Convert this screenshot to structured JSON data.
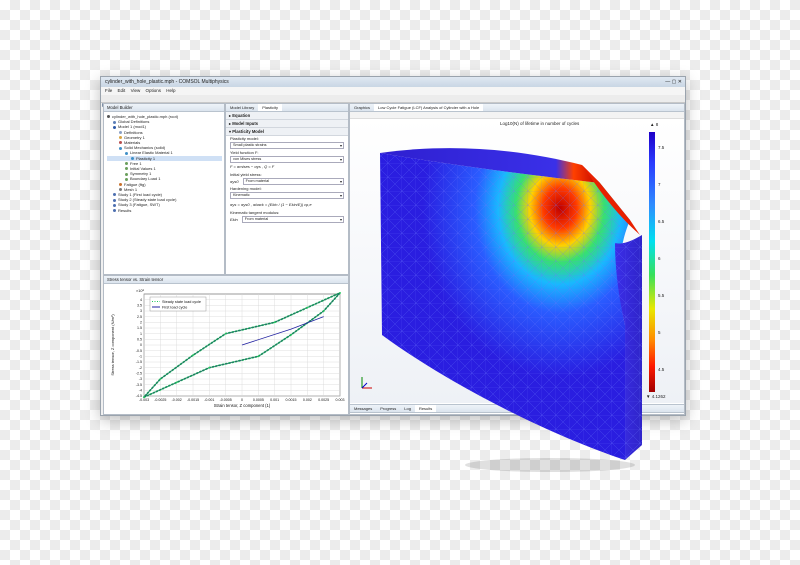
{
  "window": {
    "title": "cylinder_with_hole_plastic.mph - COMSOL Multiphysics"
  },
  "menu": [
    "File",
    "Edit",
    "View",
    "Options",
    "Help"
  ],
  "model_builder": {
    "title": "Model Builder",
    "root": "cylinder_with_hole_plastic.mph (root)",
    "items": [
      {
        "label": "Global Definitions",
        "color": "#5b7fb8"
      },
      {
        "label": "Model 1 (mod1)",
        "color": "#2e5aa8"
      },
      {
        "label": "Definitions",
        "color": "#8aa0c4"
      },
      {
        "label": "Geometry 1",
        "color": "#d9a441"
      },
      {
        "label": "Materials",
        "color": "#b84f4f"
      },
      {
        "label": "Solid Mechanics (solid)",
        "color": "#3f8fc7"
      },
      {
        "label": "Linear Elastic Material 1",
        "color": "#3f8fc7"
      },
      {
        "label": "Plasticity 1",
        "color": "#3f8fc7"
      },
      {
        "label": "Free 1",
        "color": "#6a9f5c"
      },
      {
        "label": "Initial Values 1",
        "color": "#6a9f5c"
      },
      {
        "label": "Symmetry 1",
        "color": "#6a9f5c"
      },
      {
        "label": "Boundary Load 1",
        "color": "#6a9f5c"
      },
      {
        "label": "Fatigue (ftg)",
        "color": "#c9722c"
      },
      {
        "label": "Mesh 1",
        "color": "#7a7a7a"
      },
      {
        "label": "Study 1 (First load cycle)",
        "color": "#4d6fb0"
      },
      {
        "label": "Study 2 (Steady state load cycle)",
        "color": "#4d6fb0"
      },
      {
        "label": "Study 3 (Fatigue, SWT)",
        "color": "#4d6fb0"
      },
      {
        "label": "Results",
        "color": "#4d6fb0"
      }
    ]
  },
  "settings": {
    "tabs": [
      "Model Library",
      "Plasticity"
    ],
    "sections": {
      "equation": "Equation",
      "model_inputs": "Model Inputs",
      "plasticity_model": "Plasticity Model"
    },
    "plasticity_model_label": "Plasticity model:",
    "plasticity_model_value": "Small plastic strains",
    "yield_function_label": "Yield function F:",
    "yield_function_value": "von Mises stress",
    "yield_formula": "F = σmises − σys ,  Q = F",
    "initial_yield_label": "Initial yield stress:",
    "initial_yield_symbol": "σys0",
    "initial_yield_value": "From material",
    "hardening_label": "Hardening model:",
    "hardening_value": "Kinematic",
    "hardening_formula": "σys = σys0 ,  σback = (Ekin / (1 − Ekin/E)) εp,e",
    "tangent_label": "Kinematic tangent modulus:",
    "tangent_symbol": "Ekin",
    "tangent_value": "From material"
  },
  "plot_panel": {
    "title": "Stress tensor vs. Strain tensor",
    "legend": [
      "Steady state load cycle",
      "First load cycle"
    ],
    "ylabel": "Stress tensor, Z component (N/m²)",
    "xlabel": "Strain tensor, Z component (1)",
    "exponent": "×10⁸"
  },
  "chart_data": {
    "type": "line",
    "title": "",
    "xlabel": "Strain tensor, Z component (1)",
    "ylabel": "Stress tensor, Z component (N/m²)",
    "xlim": [
      -0.003,
      0.003
    ],
    "ylim": [
      -4.5,
      4.5
    ],
    "y_scale_exponent": "×10⁸",
    "xticks": [
      "-0.003",
      "-0.0025",
      "-0.002",
      "-0.0015",
      "-0.001",
      "-0.0005",
      "0",
      "0.0005",
      "0.001",
      "0.0015",
      "0.002",
      "0.0025",
      "0.003"
    ],
    "yticks": [
      "4",
      "3.5",
      "3",
      "2.5",
      "2",
      "1.5",
      "1",
      "0.5",
      "0",
      "-0.5",
      "-1",
      "-1.5",
      "-2",
      "-2.5",
      "-3",
      "-3.5",
      "-4",
      "-4.5"
    ],
    "series": [
      {
        "name": "Steady state load cycle",
        "color": "#22c55e",
        "style": "dotted",
        "x": [
          -0.003,
          -0.002,
          -0.001,
          0.0005,
          0.0015,
          0.0025,
          0.003,
          0.002,
          0.001,
          -0.0005,
          -0.0015,
          -0.0025,
          -0.003
        ],
        "y": [
          -4.6,
          -3.3,
          -2.0,
          -1.0,
          0.9,
          3.0,
          4.6,
          3.3,
          2.0,
          1.0,
          -0.9,
          -3.0,
          -4.6
        ]
      },
      {
        "name": "First load cycle",
        "color": "#2020a0",
        "style": "solid",
        "x": [
          0,
          0.0015,
          0.0025
        ],
        "y": [
          0,
          1.4,
          2.5
        ]
      }
    ],
    "legend_position": "top-left",
    "grid": true
  },
  "graphics": {
    "tabs": [
      "Graphics",
      "Low Cycle Fatigue (LCF) Analysis of Cylinder with a Hole"
    ],
    "plot_title": "Log10(N) of lifetime in number of cycles",
    "colorbar": {
      "max_label": "▲ 8",
      "min_label": "▼ 4.1262",
      "ticks": [
        "8",
        "7.5",
        "7",
        "6.5",
        "6",
        "5.5",
        "5",
        "4.5"
      ]
    },
    "bottom_tabs": [
      "Messages",
      "Progress",
      "Log",
      "Results"
    ]
  }
}
